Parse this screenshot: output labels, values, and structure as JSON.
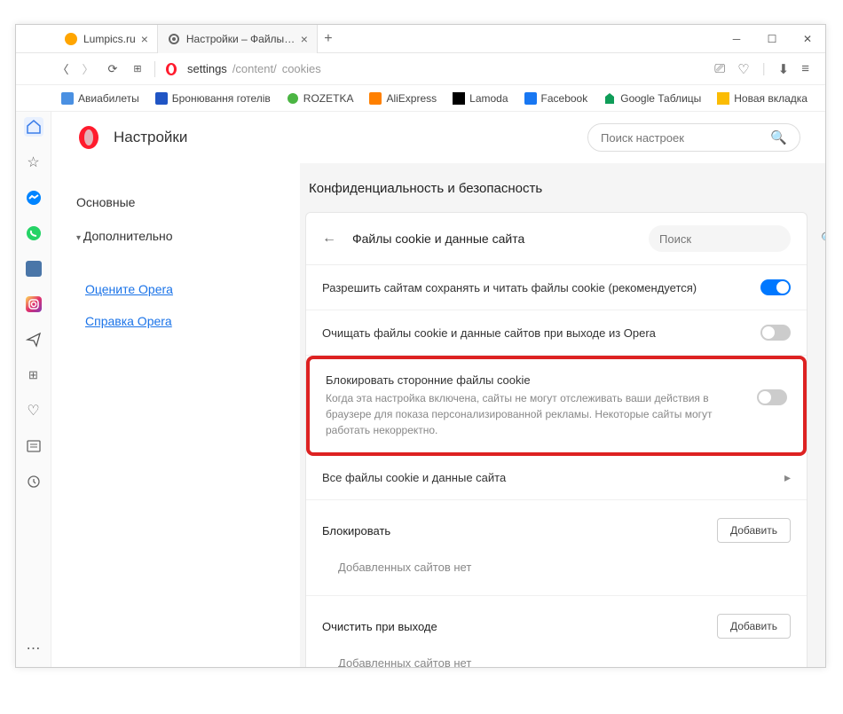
{
  "tabs": [
    {
      "title": "Lumpics.ru",
      "icon": "lumpics"
    },
    {
      "title": "Настройки – Файлы cookie",
      "icon": "gear"
    }
  ],
  "url": {
    "prefix": "settings",
    "mid": "/content/",
    "suffix": "cookies"
  },
  "bookmarks": [
    {
      "label": "Авиабилеты",
      "color": "#4a90e2"
    },
    {
      "label": "Бронювання готелів",
      "color": "#2055c4"
    },
    {
      "label": "ROZETKA",
      "color": "#4bb543"
    },
    {
      "label": "AliExpress",
      "color": "#ff8000"
    },
    {
      "label": "Lamoda",
      "color": "#000"
    },
    {
      "label": "Facebook",
      "color": "#1877f2"
    },
    {
      "label": "Google Таблицы",
      "color": "#0f9d58"
    },
    {
      "label": "Новая вкладка",
      "color": "#fbbc04"
    }
  ],
  "header": {
    "title": "Настройки",
    "search_placeholder": "Поиск настроек"
  },
  "leftnav": {
    "basic": "Основные",
    "advanced": "Дополнительно",
    "rate": "Оцените Opera",
    "help": "Справка Opera"
  },
  "section_title": "Конфиденциальность и безопасность",
  "cookies": {
    "header": "Файлы cookie и данные сайта",
    "search_placeholder": "Поиск",
    "row1": "Разрешить сайтам сохранять и читать файлы cookie (рекомендуется)",
    "row2": "Очищать файлы cookie и данные сайтов при выходе из Opera",
    "row3_title": "Блокировать сторонние файлы cookie",
    "row3_sub": "Когда эта настройка включена, сайты не могут отслеживать ваши действия в браузере для показа персонализированной рекламы. Некоторые сайты могут работать некорректно.",
    "row4": "Все файлы cookie и данные сайта"
  },
  "block": {
    "title": "Блокировать",
    "add": "Добавить",
    "empty": "Добавленных сайтов нет"
  },
  "clearexit": {
    "title": "Очистить при выходе",
    "add": "Добавить",
    "empty": "Добавленных сайтов нет"
  }
}
